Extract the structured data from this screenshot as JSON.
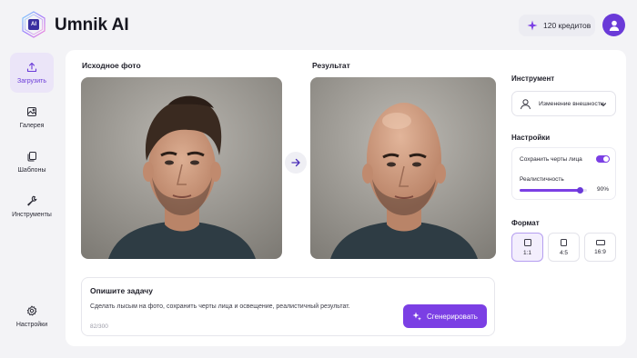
{
  "app": {
    "title": "Umnik AI",
    "logo_text": "AI"
  },
  "header": {
    "credits": "120 кредитов"
  },
  "sidebar": {
    "items": [
      {
        "label": "Загрузить",
        "icon": "upload-icon"
      },
      {
        "label": "Галерея",
        "icon": "image-icon"
      },
      {
        "label": "Шаблоны",
        "icon": "templates-icon"
      },
      {
        "label": "Инструменты",
        "icon": "wrench-icon"
      },
      {
        "label": "Настройки",
        "icon": "gear-icon"
      }
    ]
  },
  "main": {
    "source_label": "Исходное фото",
    "result_label": "Результат"
  },
  "task": {
    "title": "Опишите задачу",
    "text": "Сделать лысым на фото, сохранить черты лица и освещение, реалистичный результат.",
    "count": "82/300",
    "generate_label": "Сгенерировать"
  },
  "panel": {
    "tool_label": "Инструмент",
    "tool_value": "Изменение внешности",
    "settings_label": "Настройки",
    "keep_features_label": "Сохранить черты лица",
    "keep_features_on": true,
    "realism_label": "Реалистичность",
    "realism_value": "90%",
    "realism_fraction": 0.9,
    "format_label": "Формат",
    "formats": [
      "1:1",
      "4:5",
      "16:9"
    ],
    "selected_format": "1:1"
  },
  "colors": {
    "accent": "#7b3fe4",
    "accent_dark": "#6a3ad8"
  }
}
